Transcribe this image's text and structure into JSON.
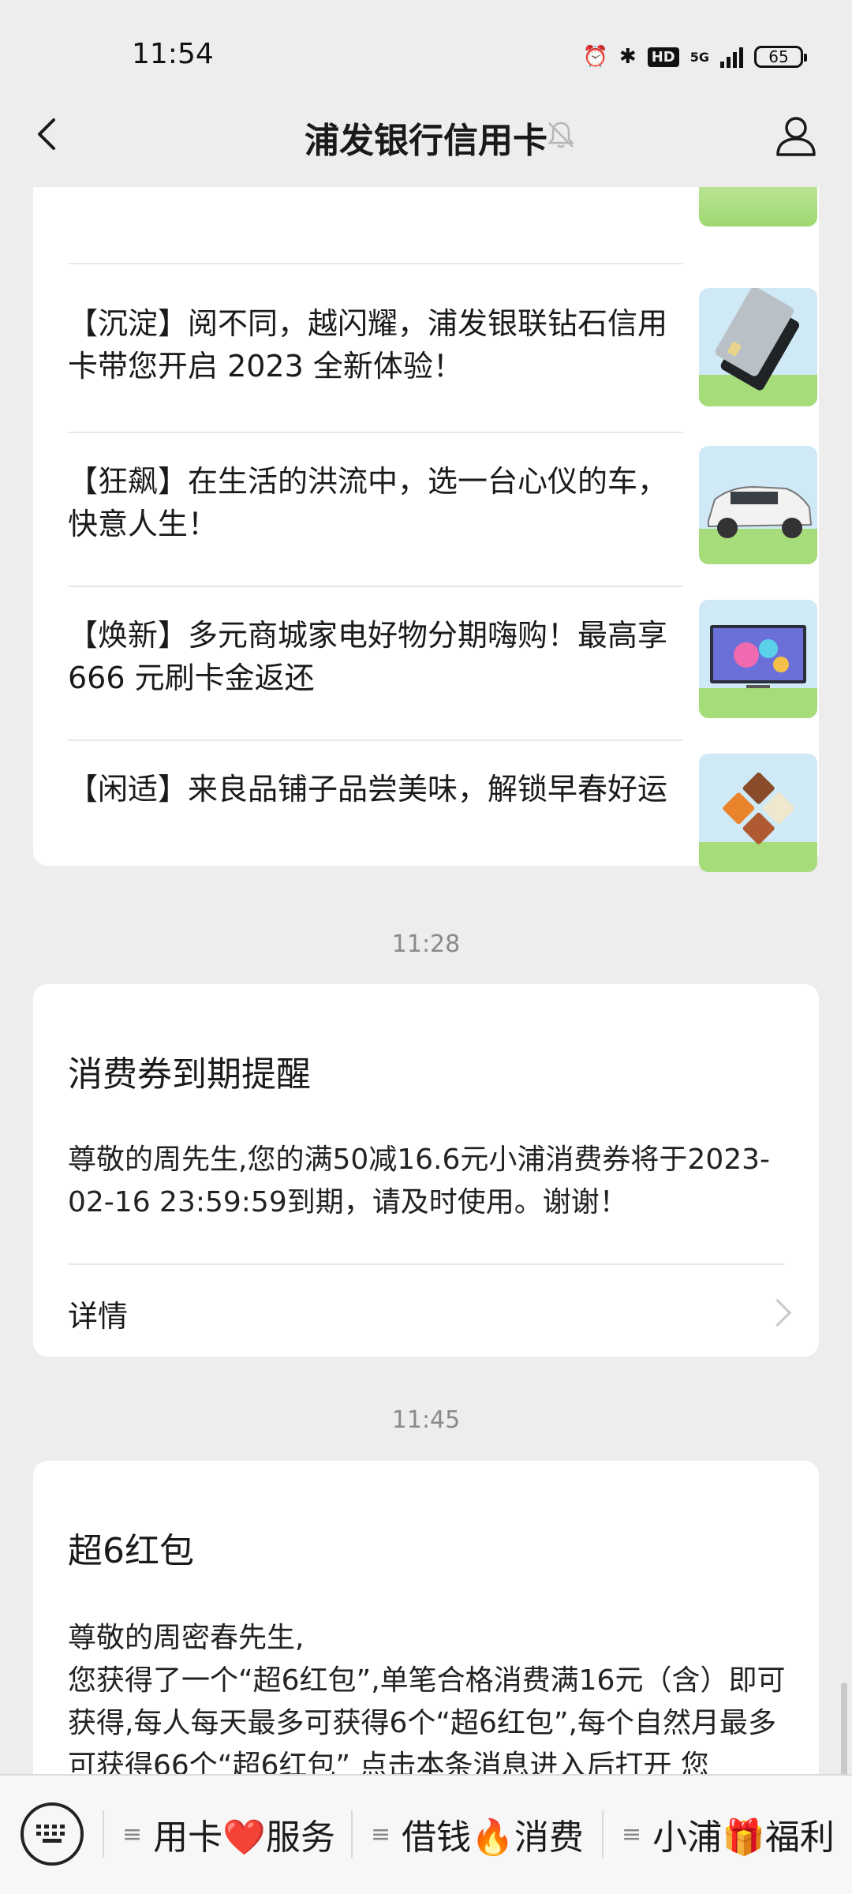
{
  "status": {
    "time": "11:54",
    "hd": "HD",
    "net": "5G",
    "battery": "65"
  },
  "header": {
    "title": "浦发银行信用卡"
  },
  "news": [
    {
      "text": "【沉淀】阅不同，越闪耀，浦发银联钻石信用卡带您开启 2023 全新体验！"
    },
    {
      "text": "【狂飙】在生活的洪流中，选一台心仪的车，快意人生！"
    },
    {
      "text": "【焕新】多元商城家电好物分期嗨购！最高享 666 元刷卡金返还"
    },
    {
      "text": "【闲适】来良品铺子品尝美味，解锁早春好运"
    }
  ],
  "messages": [
    {
      "time": "11:28",
      "title": "消费券到期提醒",
      "body": "尊敬的周先生,您的满50减16.6元小浦消费券将于2023-02-16 23:59:59到期，请及时使用。谢谢！",
      "detail": "详情"
    },
    {
      "time": "11:45",
      "title": "超6红包",
      "greeting": "尊敬的周密春先生,",
      "body": "您获得了一个“超6红包”,单笔合格消费满16元（含）即可获得,每人每天最多可获得6个“超6红包”,每个自然月最多可获得66个“超6红包” 点击本条消息进入后打开 您"
    }
  ],
  "menu": [
    {
      "label": "用卡❤️服务"
    },
    {
      "label": "借钱🔥消费"
    },
    {
      "label": "小浦🎁福利"
    }
  ]
}
